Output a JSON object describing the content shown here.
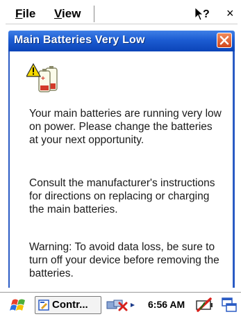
{
  "menubar": {
    "file_label": "File",
    "view_label": "View",
    "help_icon": "help-pointer-icon",
    "close_label": "×"
  },
  "dialog": {
    "title": "Main Batteries Very Low",
    "close_icon": "close-icon",
    "alert_icon": "battery-warning-icon",
    "paragraphs": [
      "Your main batteries are running very low on power. Please change the batteries at your next opportunity.",
      "Consult the manufacturer's instructions for directions on replacing or charging the main batteries.",
      "Warning: To avoid data loss, be sure to turn off your device before removing the batteries."
    ]
  },
  "taskbar": {
    "start_icon": "windows-flag-icon",
    "task_label": "Contr...",
    "clock": "6:56 AM",
    "tray_icon": "network-disconnected-icon",
    "battery_icon": "battery-critical-icon",
    "switcher_icon": "window-switcher-icon"
  },
  "colors": {
    "titlebar": "#1c5cd2",
    "close_button": "#d2451a",
    "warning_yellow": "#f5d800"
  }
}
